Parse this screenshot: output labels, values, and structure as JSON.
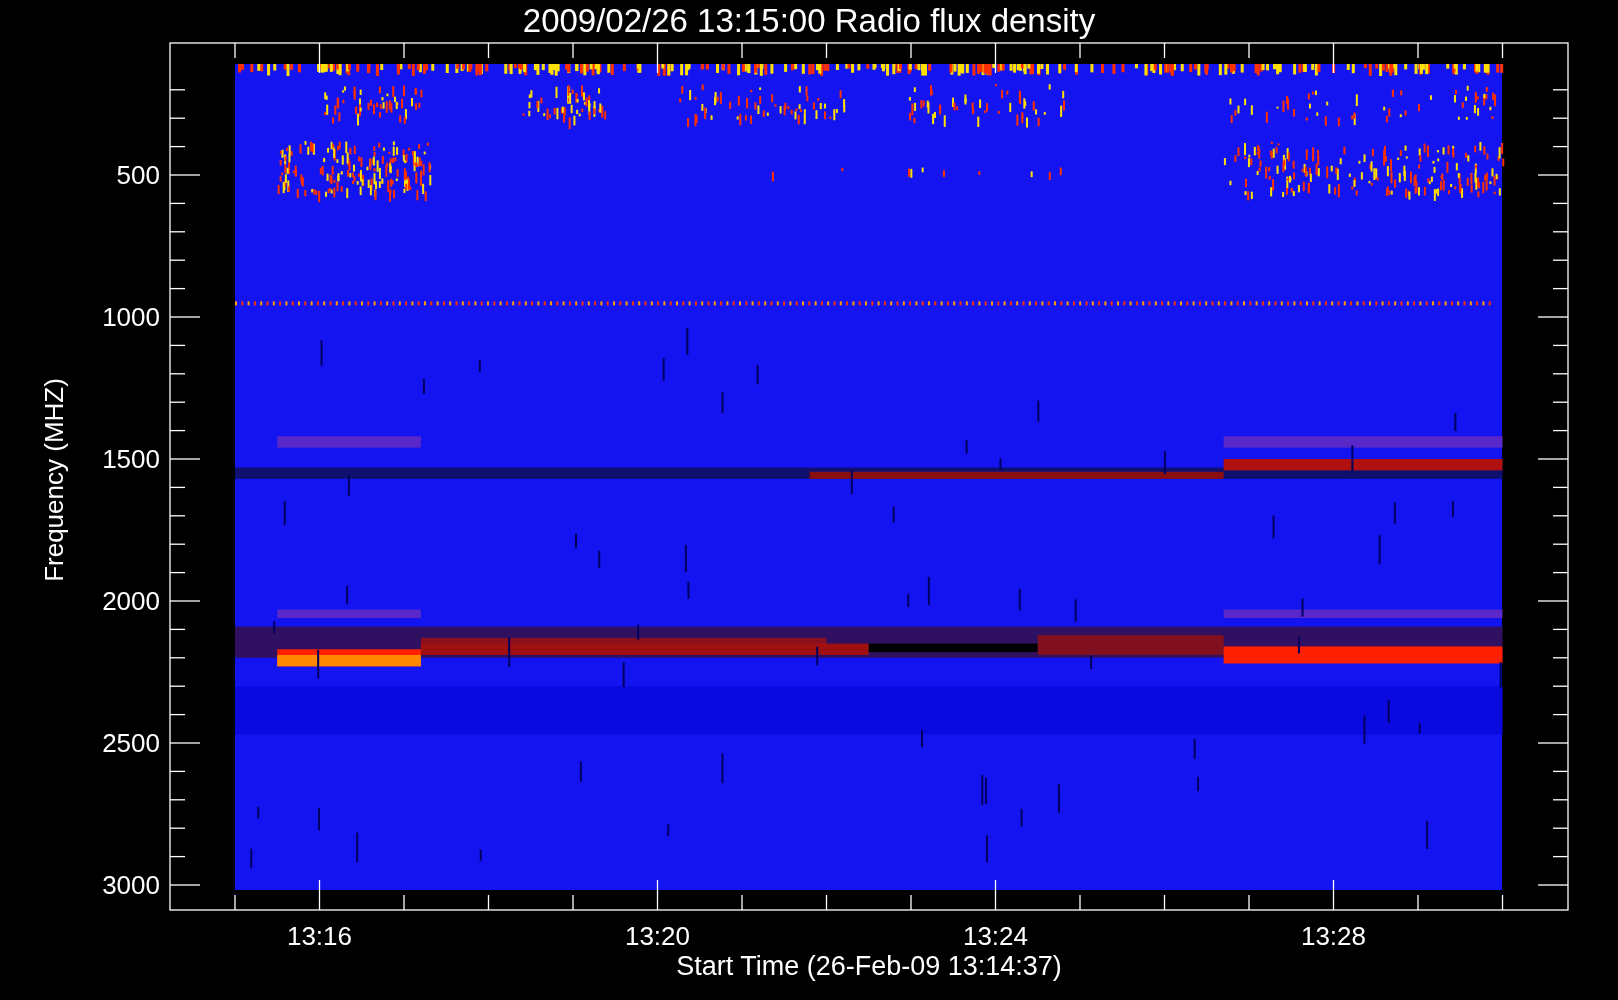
{
  "plot": {
    "title": "2009/02/26 13:15:00 Radio flux density",
    "ylabel": "Frequency (MHZ)",
    "xlabel": "Start Time (26-Feb-09 13:14:37)",
    "y_tick_labels": [
      "500",
      "1000",
      "1500",
      "2000",
      "2500",
      "3000"
    ],
    "x_tick_labels": [
      "13:16",
      "13:20",
      "13:24",
      "13:28"
    ]
  }
}
